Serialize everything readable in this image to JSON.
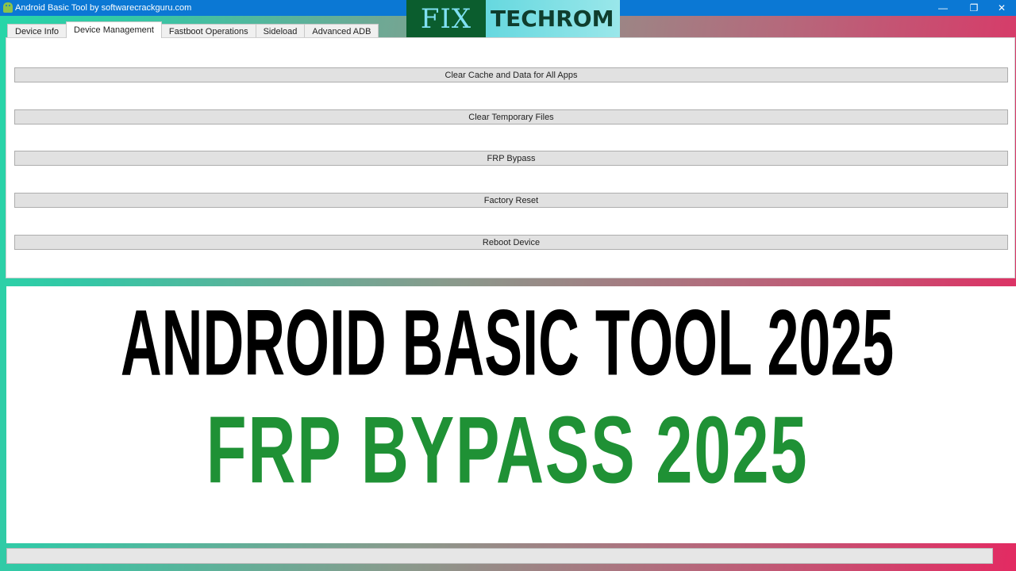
{
  "window": {
    "title": "Android Basic Tool by softwarecrackguru.com",
    "controls": {
      "minimize": "—",
      "restore": "❐",
      "close": "✕"
    },
    "icon": "android-icon"
  },
  "logo": {
    "part1": "FIX",
    "part2": "TECHROM"
  },
  "tabs": [
    {
      "label": "Device Info"
    },
    {
      "label": "Device Management",
      "active": true
    },
    {
      "label": "Fastboot Operations"
    },
    {
      "label": "Sideload"
    },
    {
      "label": "Advanced ADB"
    }
  ],
  "actions": [
    {
      "label": "Clear Cache and Data for All Apps"
    },
    {
      "label": "Clear Temporary Files"
    },
    {
      "label": "FRP Bypass"
    },
    {
      "label": "Factory Reset"
    },
    {
      "label": "Reboot Device"
    }
  ],
  "banner": {
    "line1": "ANDROID BASIC TOOL 2025",
    "line2": "FRP BYPASS 2025"
  },
  "colors": {
    "titlebar": "#0b78d4",
    "headline_green": "#1f9135",
    "headline_black": "#000000"
  }
}
